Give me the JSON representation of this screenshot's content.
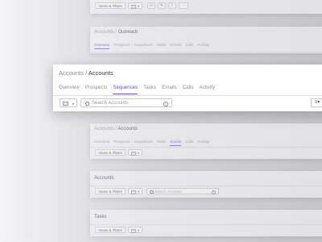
{
  "card1": {
    "views_filters": "Views & Filters",
    "icons": [
      "calendar-icon",
      "pen-icon",
      "paperclip-icon",
      "more-icon"
    ],
    "more_text": "···"
  },
  "card2": {
    "breadcrumb": {
      "parent": "Accounts",
      "sep": "/",
      "current": "Outreach"
    },
    "tabs": [
      "Overview",
      "Prospects",
      "Sequences",
      "Tasks",
      "Emails",
      "Calls",
      "Activity"
    ],
    "active_tab": "Overview"
  },
  "main": {
    "breadcrumb": {
      "parent": "Accounts",
      "sep": "/",
      "current": "Accounts"
    },
    "tabs": [
      "Overview",
      "Prospects",
      "Sequences",
      "Tasks",
      "Emails",
      "Calls",
      "Activity"
    ],
    "active_tab": "Sequences",
    "search": {
      "placeholder": "Search Accounts"
    }
  },
  "card4": {
    "breadcrumb": {
      "parent": "Accounts",
      "sep": "/",
      "current": "Accounts"
    },
    "tabs": [
      "Overview",
      "Prospects",
      "Sequences",
      "Tasks",
      "Emails",
      "Calls",
      "Activity"
    ],
    "active_tab": "Emails",
    "views_filters": "Views & Filters"
  },
  "card5": {
    "title": "Accounts",
    "views_filters": "Views & Filters",
    "search": {
      "placeholder": "Search Accounts"
    }
  },
  "card6": {
    "title": "Tasks",
    "views_filters": "Views & Filters"
  },
  "colors": {
    "accent": "#5b55e6",
    "background": "#d4d4d8",
    "card": "#f5f5f7",
    "border": "#c9c9d1"
  }
}
